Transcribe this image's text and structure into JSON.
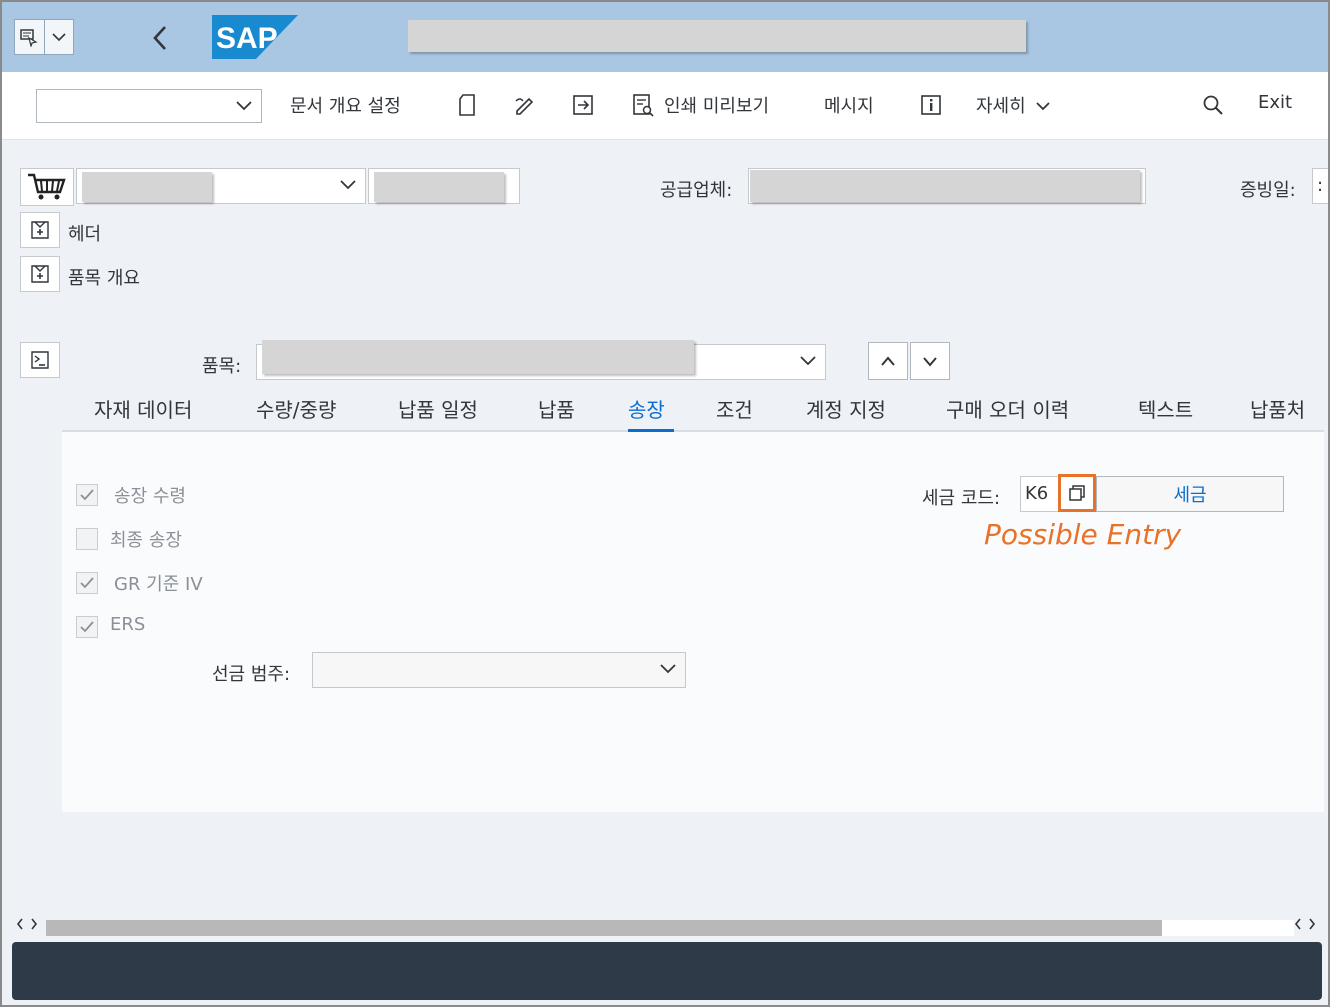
{
  "toolbar": {
    "document_overview": "문서 개요 설정",
    "print_preview": "인쇄 미리보기",
    "messages": "메시지",
    "more": "자세히",
    "exit": "Exit"
  },
  "header": {
    "vendor_label": "공급업체:",
    "doc_date_label": "증빙일:",
    "date_value": ":"
  },
  "sections": {
    "header": "헤더",
    "item_overview": "품목 개요"
  },
  "item": {
    "label": "품목:"
  },
  "tabs": [
    {
      "label": "자재 데이터"
    },
    {
      "label": "수량/중량"
    },
    {
      "label": "납품 일정"
    },
    {
      "label": "납품"
    },
    {
      "label": "송장"
    },
    {
      "label": "조건"
    },
    {
      "label": "계정 지정"
    },
    {
      "label": "구매 오더 이력"
    },
    {
      "label": "텍스트"
    },
    {
      "label": "납품처"
    }
  ],
  "invoice": {
    "checkboxes": [
      {
        "label": "송장 수령",
        "checked": true
      },
      {
        "label": "최종 송장",
        "checked": false
      },
      {
        "label": "GR 기준 IV",
        "checked": true
      },
      {
        "label": "ERS",
        "checked": true
      }
    ],
    "tax_code_label": "세금 코드:",
    "tax_code_value": "K6",
    "tax_button": "세금",
    "dp_category_label": "선금 범주:",
    "annotation": "Possible Entry"
  },
  "colors": {
    "shell": "#a9c6e3",
    "accent": "#0a6ed1",
    "highlight": "#e8722a",
    "statusbar": "#2e3a47"
  }
}
